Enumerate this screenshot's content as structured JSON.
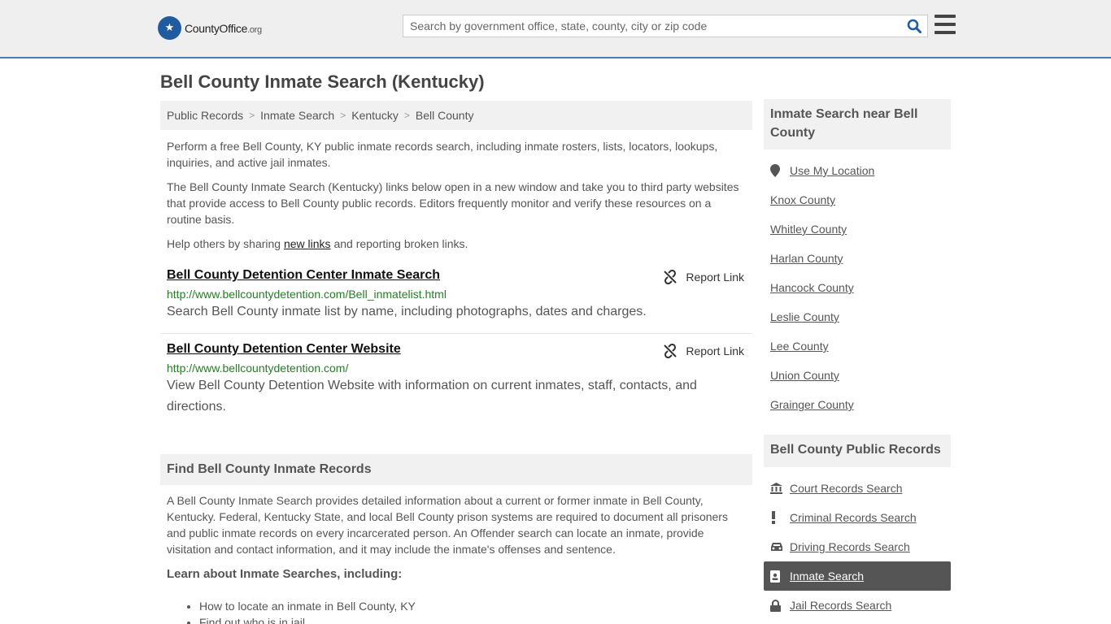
{
  "header": {
    "logo_main": "CountyOffice",
    "logo_suffix": ".org",
    "search_placeholder": "Search by government office, state, county, city or zip code"
  },
  "page": {
    "title": "Bell County Inmate Search (Kentucky)"
  },
  "breadcrumb": [
    "Public Records",
    "Inmate Search",
    "Kentucky",
    "Bell County"
  ],
  "intro": {
    "p1": "Perform a free Bell County, KY public inmate records search, including inmate rosters, lists, locators, lookups, inquiries, and active jail inmates.",
    "p2": "The Bell County Inmate Search (Kentucky) links below open in a new window and take you to third party websites that provide access to Bell County public records. Editors frequently monitor and verify these resources on a routine basis.",
    "p3_before": "Help others by sharing ",
    "p3_link": "new links",
    "p3_after": " and reporting broken links."
  },
  "results": [
    {
      "title": "Bell County Detention Center Inmate Search",
      "url": "http://www.bellcountydetention.com/Bell_inmatelist.html",
      "desc": "Search Bell County inmate list by name, including photographs, dates and charges.",
      "report": "Report Link"
    },
    {
      "title": "Bell County Detention Center Website",
      "url": "http://www.bellcountydetention.com/",
      "desc": "View Bell County Detention Website with information on current inmates, staff, contacts, and directions.",
      "report": "Report Link"
    }
  ],
  "find_section": {
    "heading": "Find Bell County Inmate Records",
    "text": "A Bell County Inmate Search provides detailed information about a current or former inmate in Bell County, Kentucky. Federal, Kentucky State, and local Bell County prison systems are required to document all prisoners and public inmate records on every incarcerated person. An Offender search can locate an inmate, provide visitation and contact information, and it may include the inmate's offenses and sentence.",
    "learn": "Learn about Inmate Searches, including:",
    "bullets": [
      "How to locate an inmate in Bell County, KY",
      "Find out who is in jail"
    ]
  },
  "sidebar": {
    "nearby_heading": "Inmate Search near Bell County",
    "use_location": "Use My Location",
    "nearby": [
      "Knox County",
      "Whitley County",
      "Harlan County",
      "Hancock County",
      "Leslie County",
      "Lee County",
      "Union County",
      "Grainger County"
    ],
    "records_heading": "Bell County Public Records",
    "records": [
      {
        "label": "Court Records Search",
        "icon": "courthouse-icon"
      },
      {
        "label": "Criminal Records Search",
        "icon": "exclamation-icon"
      },
      {
        "label": "Driving Records Search",
        "icon": "car-icon"
      },
      {
        "label": "Inmate Search",
        "icon": "id-badge-icon"
      },
      {
        "label": "Jail Records Search",
        "icon": "lock-icon"
      }
    ],
    "active_record": "Inmate Search"
  }
}
